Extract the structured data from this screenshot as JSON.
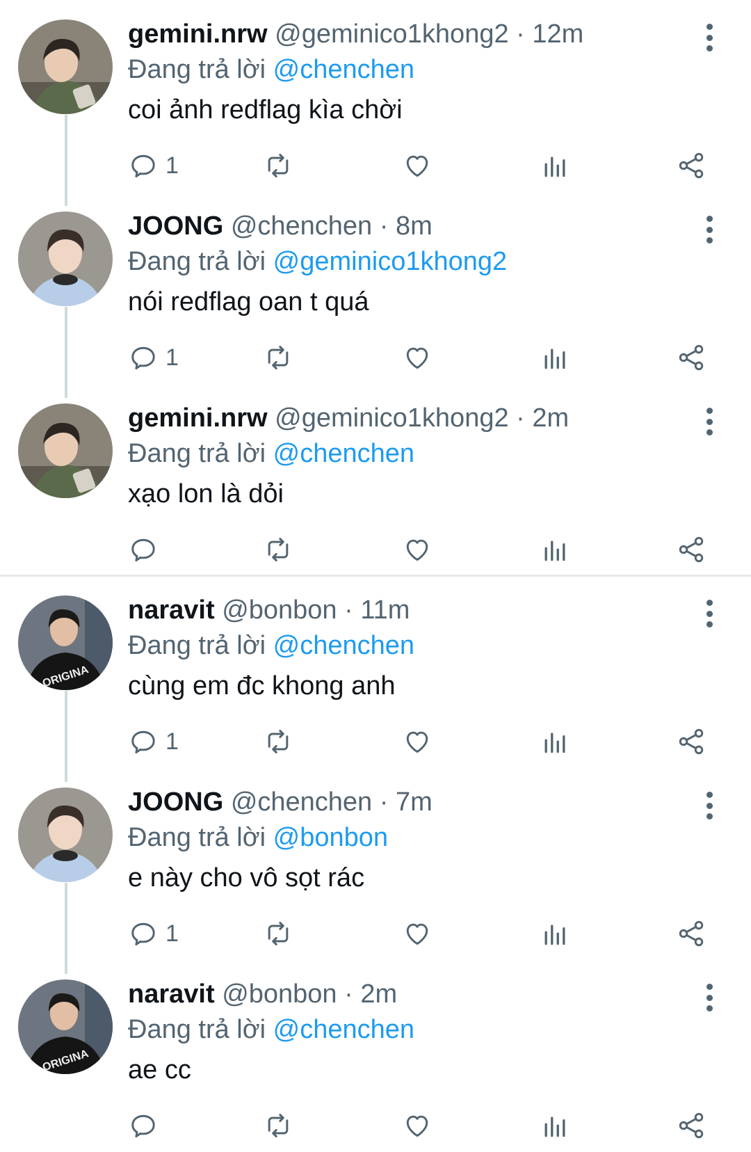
{
  "reply_prefix": "Đang trả lời",
  "colors": {
    "mention": "#1d9bf0",
    "muted": "#536471",
    "text": "#0f1419",
    "thread_line": "#cfd9de"
  },
  "icons": {
    "reply": "reply-icon",
    "retweet": "retweet-icon",
    "like": "heart-icon",
    "views": "views-icon",
    "share": "share-icon",
    "more": "more-vertical-icon"
  },
  "threads": [
    {
      "tweets": [
        {
          "name": "gemini.nrw",
          "handle": "@geminico1khong2",
          "time": "· 12m",
          "reply_to": "@chenchen",
          "text": "coi ảnh redflag kìa chời",
          "reply_count": "1"
        },
        {
          "name": "JOONG",
          "handle": "@chenchen",
          "time": "· 8m",
          "reply_to": "@geminico1khong2",
          "text": "nói redflag oan t quá",
          "reply_count": "1"
        },
        {
          "name": "gemini.nrw",
          "handle": "@geminico1khong2",
          "time": "· 2m",
          "reply_to": "@chenchen",
          "text": "xạo lon là dỏi",
          "reply_count": ""
        }
      ]
    },
    {
      "tweets": [
        {
          "name": "naravit",
          "handle": "@bonbon",
          "time": "· 11m",
          "reply_to": "@chenchen",
          "text": "cùng em đc khong anh",
          "reply_count": "1"
        },
        {
          "name": "JOONG",
          "handle": "@chenchen",
          "time": "· 7m",
          "reply_to": "@bonbon",
          "text": "e này cho vô sọt rác",
          "reply_count": "1"
        },
        {
          "name": "naravit",
          "handle": "@bonbon",
          "time": "· 2m",
          "reply_to": "@chenchen",
          "text": "ae cc",
          "reply_count": ""
        }
      ]
    }
  ]
}
